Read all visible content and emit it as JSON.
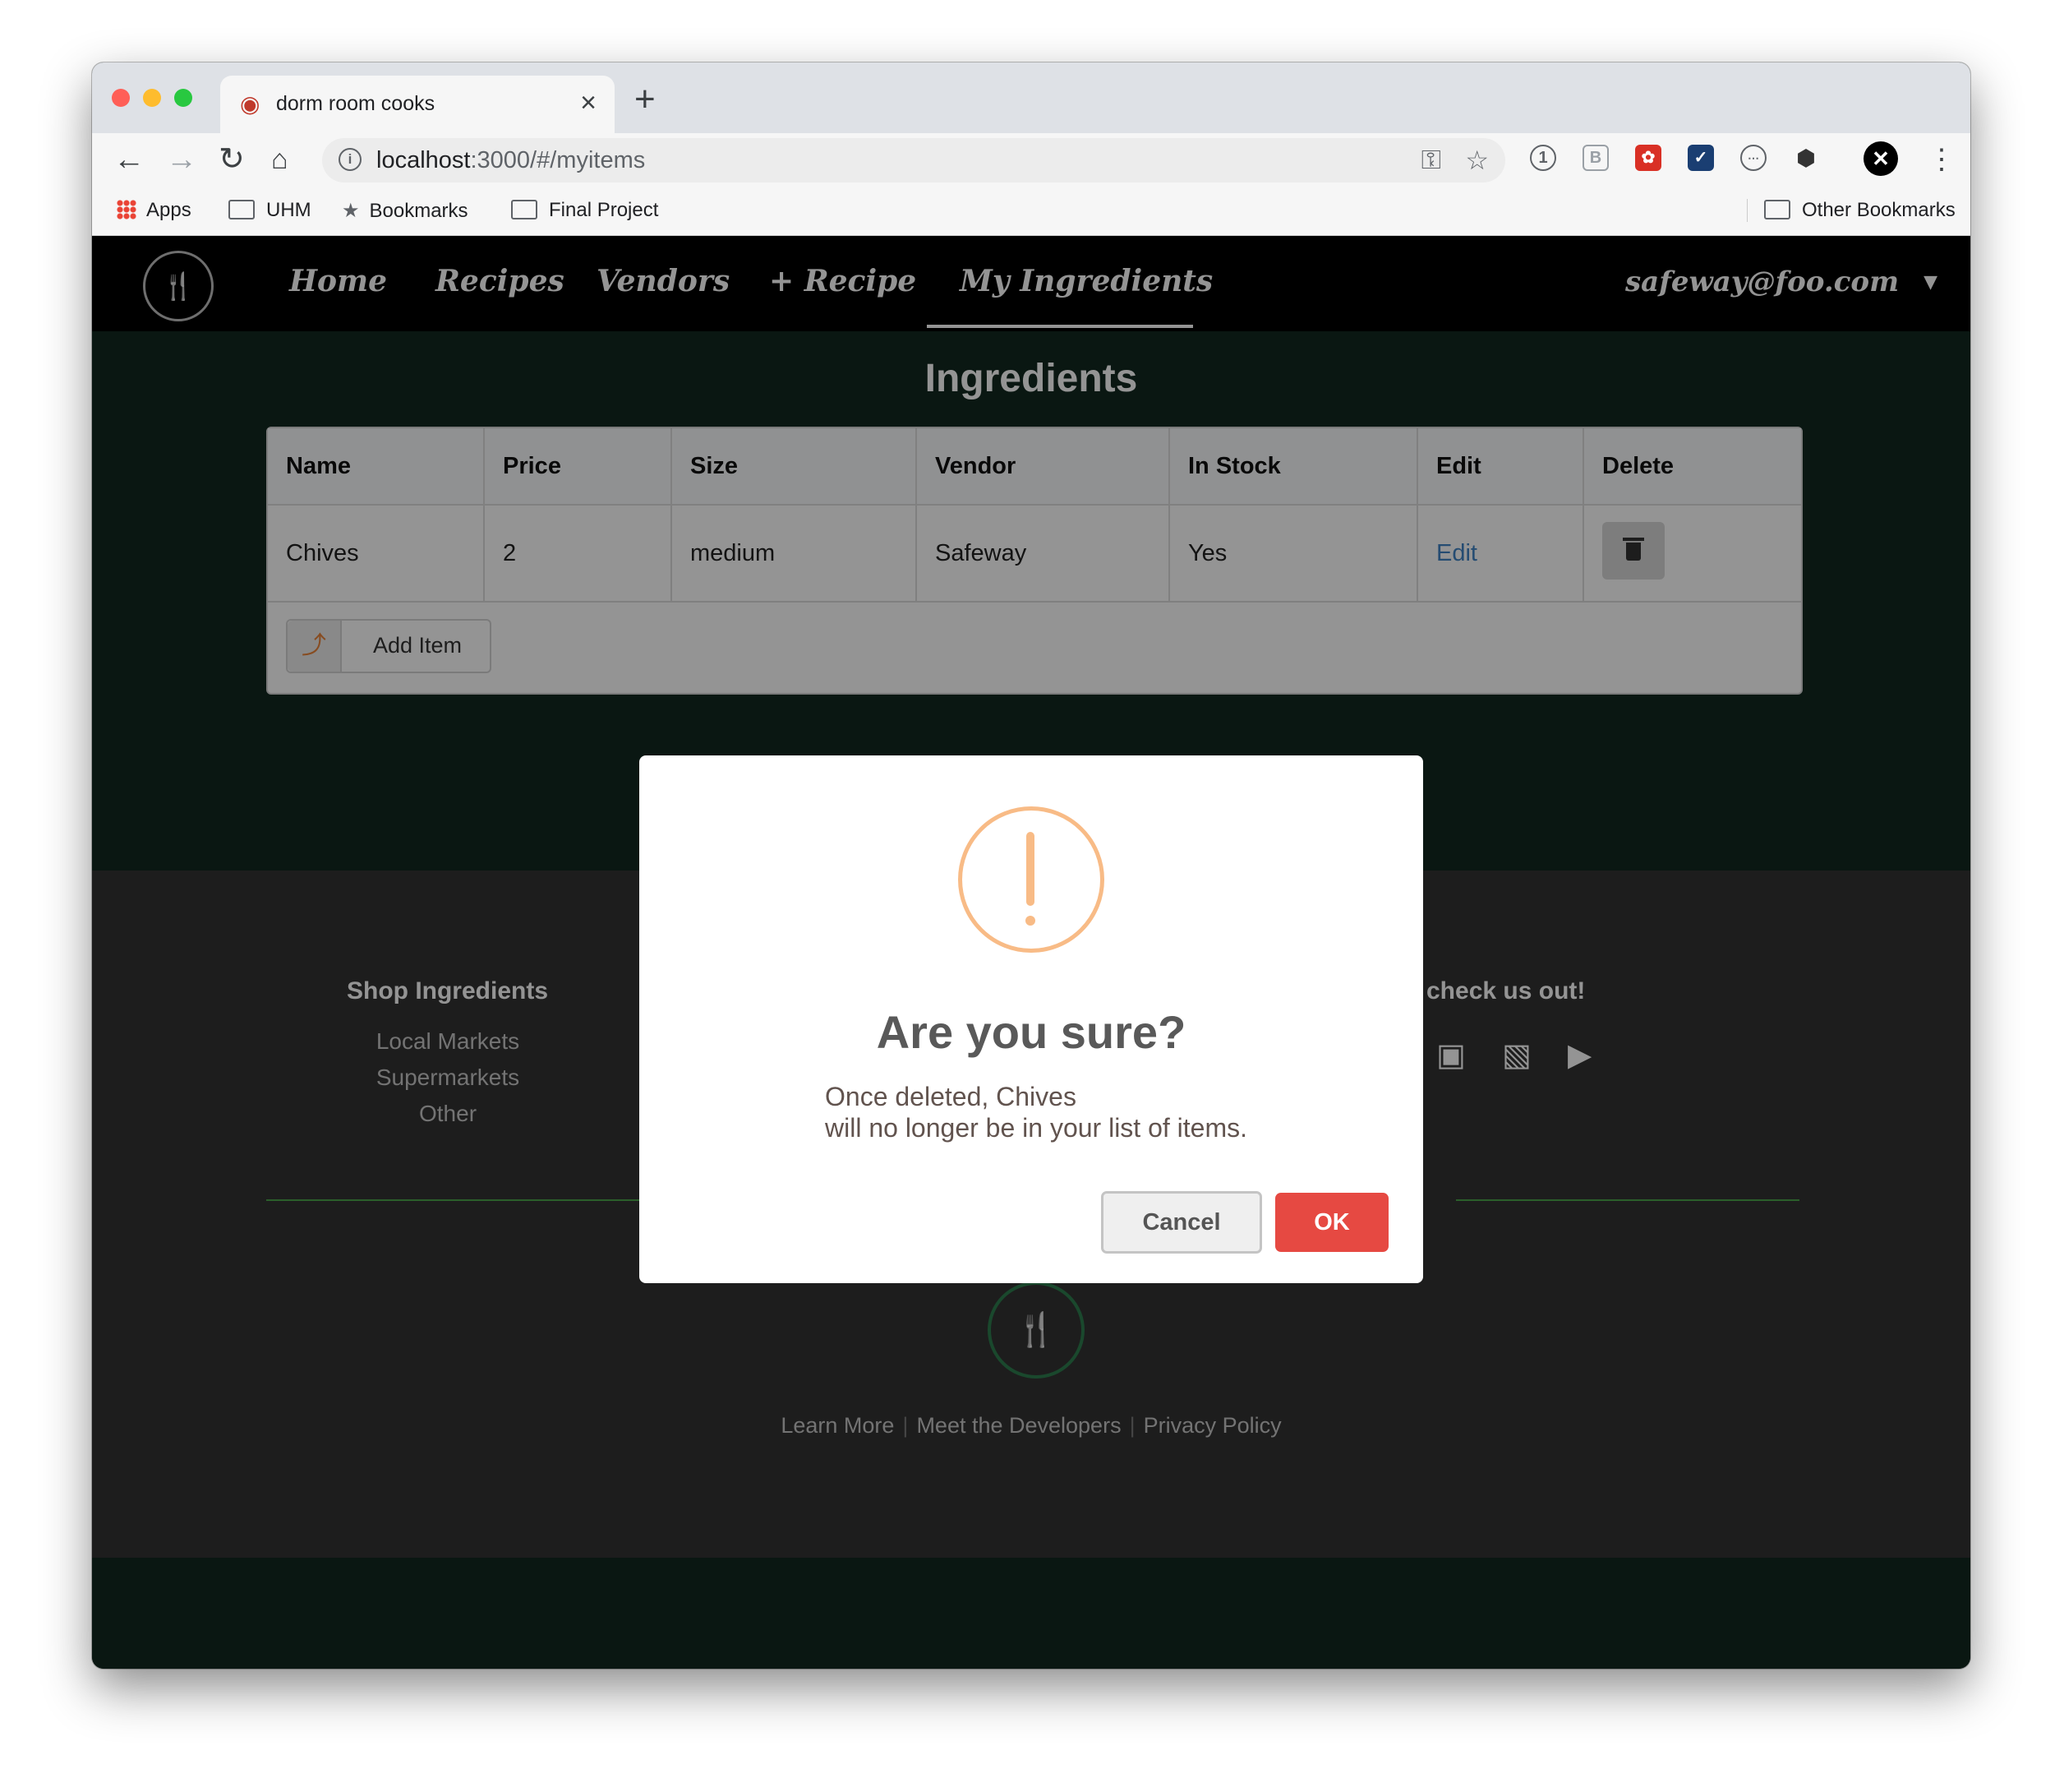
{
  "browser": {
    "tab_title": "dorm room cooks",
    "tab_close": "×",
    "new_tab": "+",
    "url_host": "localhost",
    "url_rest": ":3000/#/myitems",
    "bookmarks": {
      "apps": "Apps",
      "uhm": "UHM",
      "bookmarks": "Bookmarks",
      "final_project": "Final Project",
      "other": "Other Bookmarks"
    }
  },
  "navbar": {
    "home": "Home",
    "recipes": "Recipes",
    "vendors": "Vendors",
    "add_recipe": "+ Recipe",
    "my_ingredients": "My Ingredients",
    "user": "safeway@foo.com"
  },
  "page": {
    "heading": "Ingredients",
    "table": {
      "headers": [
        "Name",
        "Price",
        "Size",
        "Vendor",
        "In Stock",
        "Edit",
        "Delete"
      ],
      "rows": [
        {
          "name": "Chives",
          "price": "2",
          "size": "medium",
          "vendor": "Safeway",
          "in_stock": "Yes",
          "edit": "Edit"
        }
      ]
    },
    "add_item": "Add Item"
  },
  "footer": {
    "shop_title": "Shop Ingredients",
    "shop_links": [
      "Local Markets",
      "Supermarkets",
      "Other"
    ],
    "social_title": "check us out!",
    "bottom_links": [
      "Learn More",
      "Meet the Developers",
      "Privacy Policy"
    ]
  },
  "modal": {
    "title": "Are you sure?",
    "line1": "Once deleted, Chives",
    "line2": "will no longer be in your list of items.",
    "cancel": "Cancel",
    "ok": "OK",
    "accent_color": "#f8bb86",
    "ok_color": "#e64942"
  }
}
